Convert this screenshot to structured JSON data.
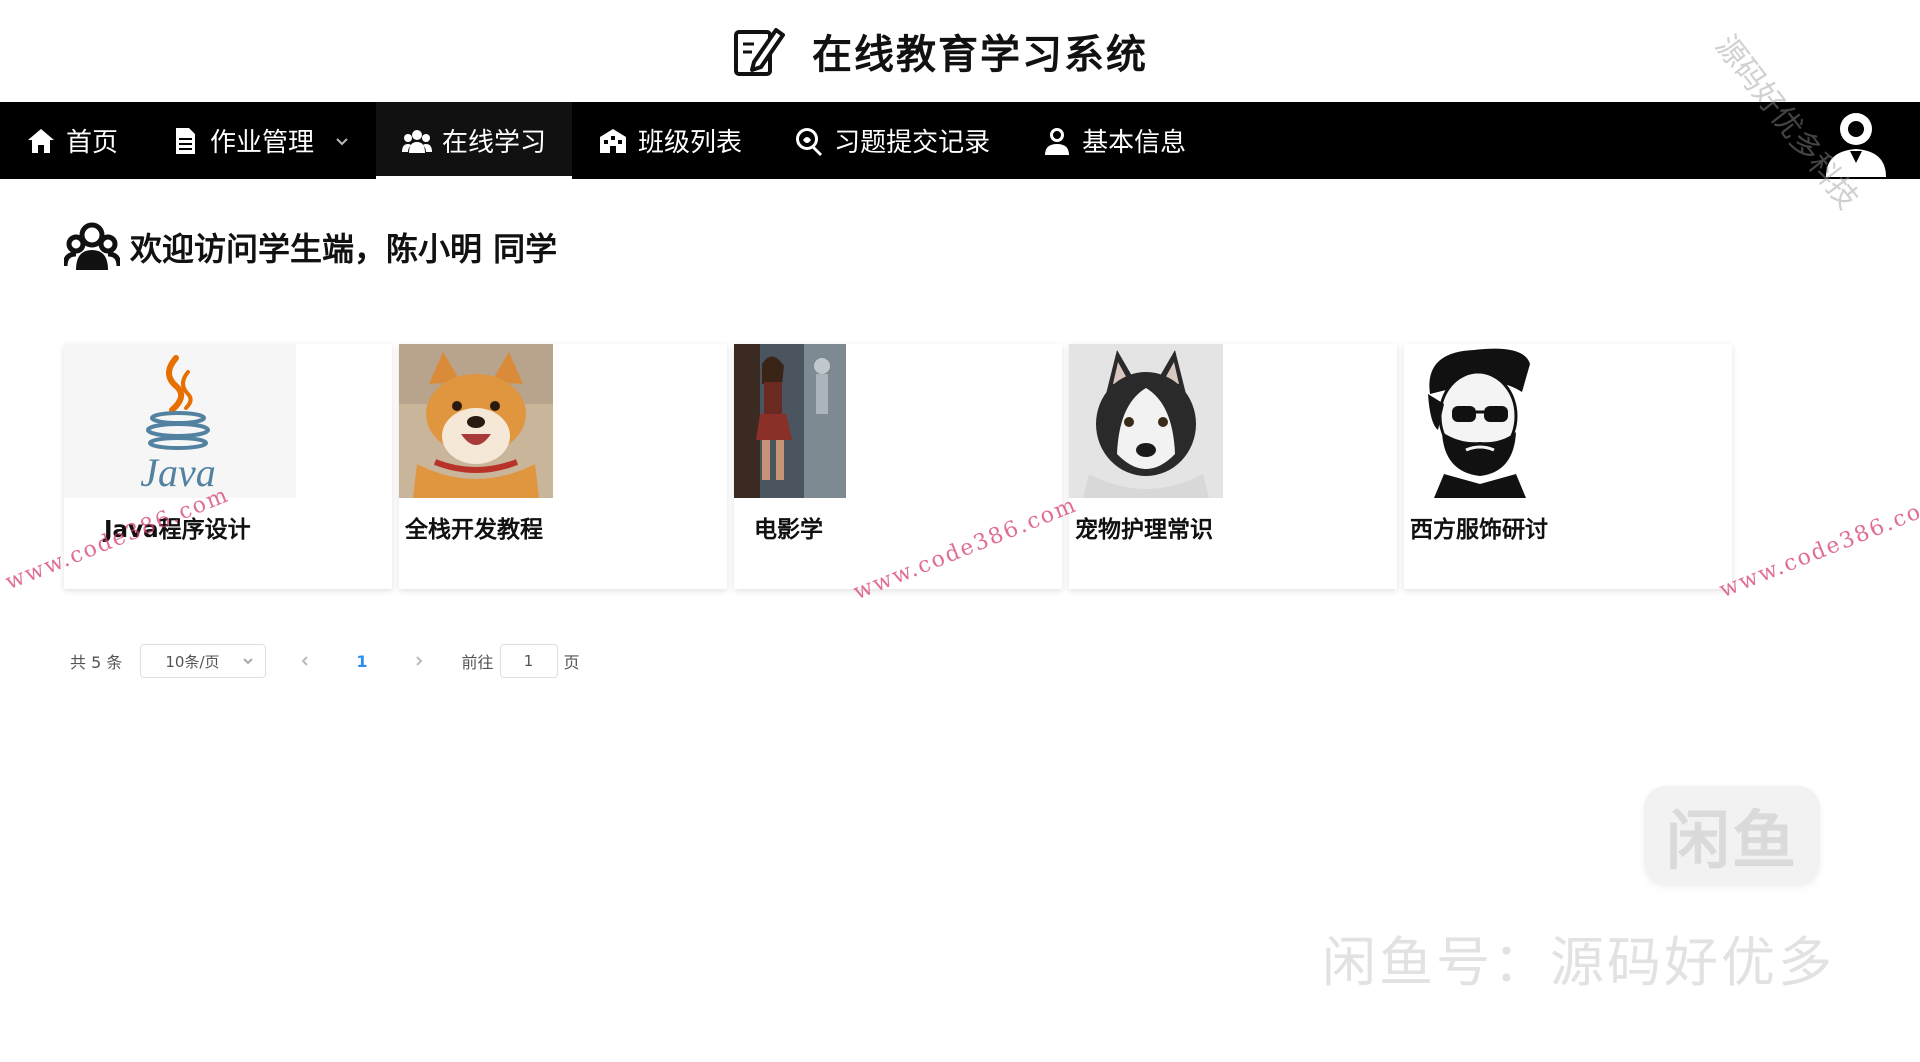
{
  "header": {
    "title": "在线教育学习系统",
    "logo_icon": "pen-edit-icon"
  },
  "nav": {
    "items": [
      {
        "label": "首页",
        "icon": "home-icon"
      },
      {
        "label": "作业管理",
        "icon": "document-icon",
        "dropdown": true
      },
      {
        "label": "在线学习",
        "icon": "users-group-icon",
        "active": true
      },
      {
        "label": "班级列表",
        "icon": "school-icon"
      },
      {
        "label": "习题提交记录",
        "icon": "search-record-icon"
      },
      {
        "label": "基本信息",
        "icon": "user-icon"
      }
    ],
    "avatar_icon": "user-avatar-icon"
  },
  "welcome": {
    "text": "欢迎访问学生端，陈小明 同学",
    "icon": "users-group-icon"
  },
  "courses": [
    {
      "title": "Java程序设计",
      "image": "java-logo"
    },
    {
      "title": "全栈开发教程",
      "image": "shiba-dog-photo"
    },
    {
      "title": "电影学",
      "image": "movie-poster-photo"
    },
    {
      "title": "宠物护理常识",
      "image": "husky-dog-photo"
    },
    {
      "title": "西方服饰研讨",
      "image": "bearded-man-illustration"
    }
  ],
  "pagination": {
    "total_text": "共 5 条",
    "page_size": "10条/页",
    "current_page": "1",
    "goto_label": "前往",
    "goto_value": "1",
    "page_suffix": "页"
  },
  "watermarks": {
    "site": "www.code386.com",
    "corner": "源码好优多科技",
    "badge": "闲鱼",
    "bottom": "闲鱼号：源码好优多"
  },
  "colors": {
    "nav_bg": "#000000",
    "accent": "#2d8cf0",
    "watermark": "#d63c6e"
  }
}
